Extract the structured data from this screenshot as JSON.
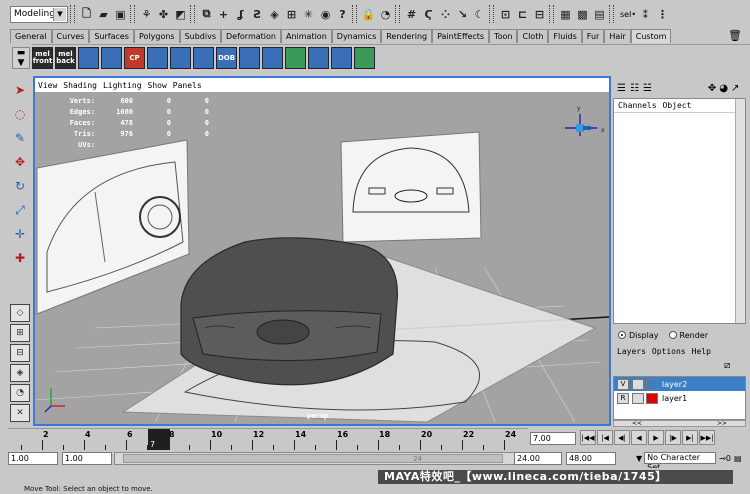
{
  "statusline": {
    "mode": "Modeling",
    "sel_label": "sel•"
  },
  "shelf_tabs": [
    "General",
    "Curves",
    "Surfaces",
    "Polygons",
    "Subdivs",
    "Deformation",
    "Animation",
    "Dynamics",
    "Rendering",
    "PaintEffects",
    "Toon",
    "Cloth",
    "Fluids",
    "Fur",
    "Hair",
    "Custom"
  ],
  "shelf_icons": [
    {
      "label": "mel\nfront",
      "style": "txt"
    },
    {
      "label": "mel\nback",
      "style": "txt"
    },
    {
      "label": "",
      "style": "blue"
    },
    {
      "label": "",
      "style": "blue"
    },
    {
      "label": "CP",
      "style": "red"
    },
    {
      "label": "",
      "style": "blue"
    },
    {
      "label": "",
      "style": "blue"
    },
    {
      "label": "",
      "style": "blue"
    },
    {
      "label": "DOB",
      "style": "blue"
    },
    {
      "label": "",
      "style": "blue"
    },
    {
      "label": "",
      "style": "blue"
    },
    {
      "label": "",
      "style": "grn"
    },
    {
      "label": "",
      "style": "blue"
    },
    {
      "label": "",
      "style": "blue"
    },
    {
      "label": "",
      "style": "grn"
    }
  ],
  "viewport": {
    "menu": [
      "View",
      "Shading",
      "Lighting",
      "Show",
      "Panels"
    ],
    "hud": [
      {
        "label": "Verts:",
        "v1": "600",
        "v2": "0",
        "v3": "0"
      },
      {
        "label": "Edges:",
        "v1": "1080",
        "v2": "0",
        "v3": "0"
      },
      {
        "label": "Faces:",
        "v1": "478",
        "v2": "0",
        "v3": "0"
      },
      {
        "label": "Tris:",
        "v1": "976",
        "v2": "0",
        "v3": "0"
      },
      {
        "label": "UVs:",
        "v1": "",
        "v2": "",
        "v3": ""
      }
    ],
    "camera": "persp",
    "bg_color": "#a3a3a3",
    "border_color": "#3c78d8"
  },
  "channelbox": {
    "menu": [
      "Channels",
      "Object"
    ]
  },
  "layers": {
    "mode_display": "Display",
    "mode_render": "Render",
    "menu": [
      "Layers",
      "Options",
      "Help"
    ],
    "items": [
      {
        "vis": "V",
        "name": "layer2",
        "selected": true,
        "color": "#3d7fc4"
      },
      {
        "vis": "R",
        "name": "layer1",
        "selected": false,
        "color": "#e00000"
      }
    ]
  },
  "timeline": {
    "ticks": [
      "2",
      "4",
      "6",
      "8",
      "10",
      "12",
      "14",
      "16",
      "18",
      "20",
      "22",
      "24"
    ],
    "current_frame": "7",
    "current_field": "7.00"
  },
  "range": {
    "start_anim": "1.00",
    "start_play": "1.00",
    "handle_label": "24",
    "end_play": "24.00",
    "end_anim": "48.00",
    "character_set": "No Character Set"
  },
  "watermark": "MAYA特效吧_【www.lineca.com/tieba/1745】",
  "helpline": "Move Tool: Select an object to move."
}
